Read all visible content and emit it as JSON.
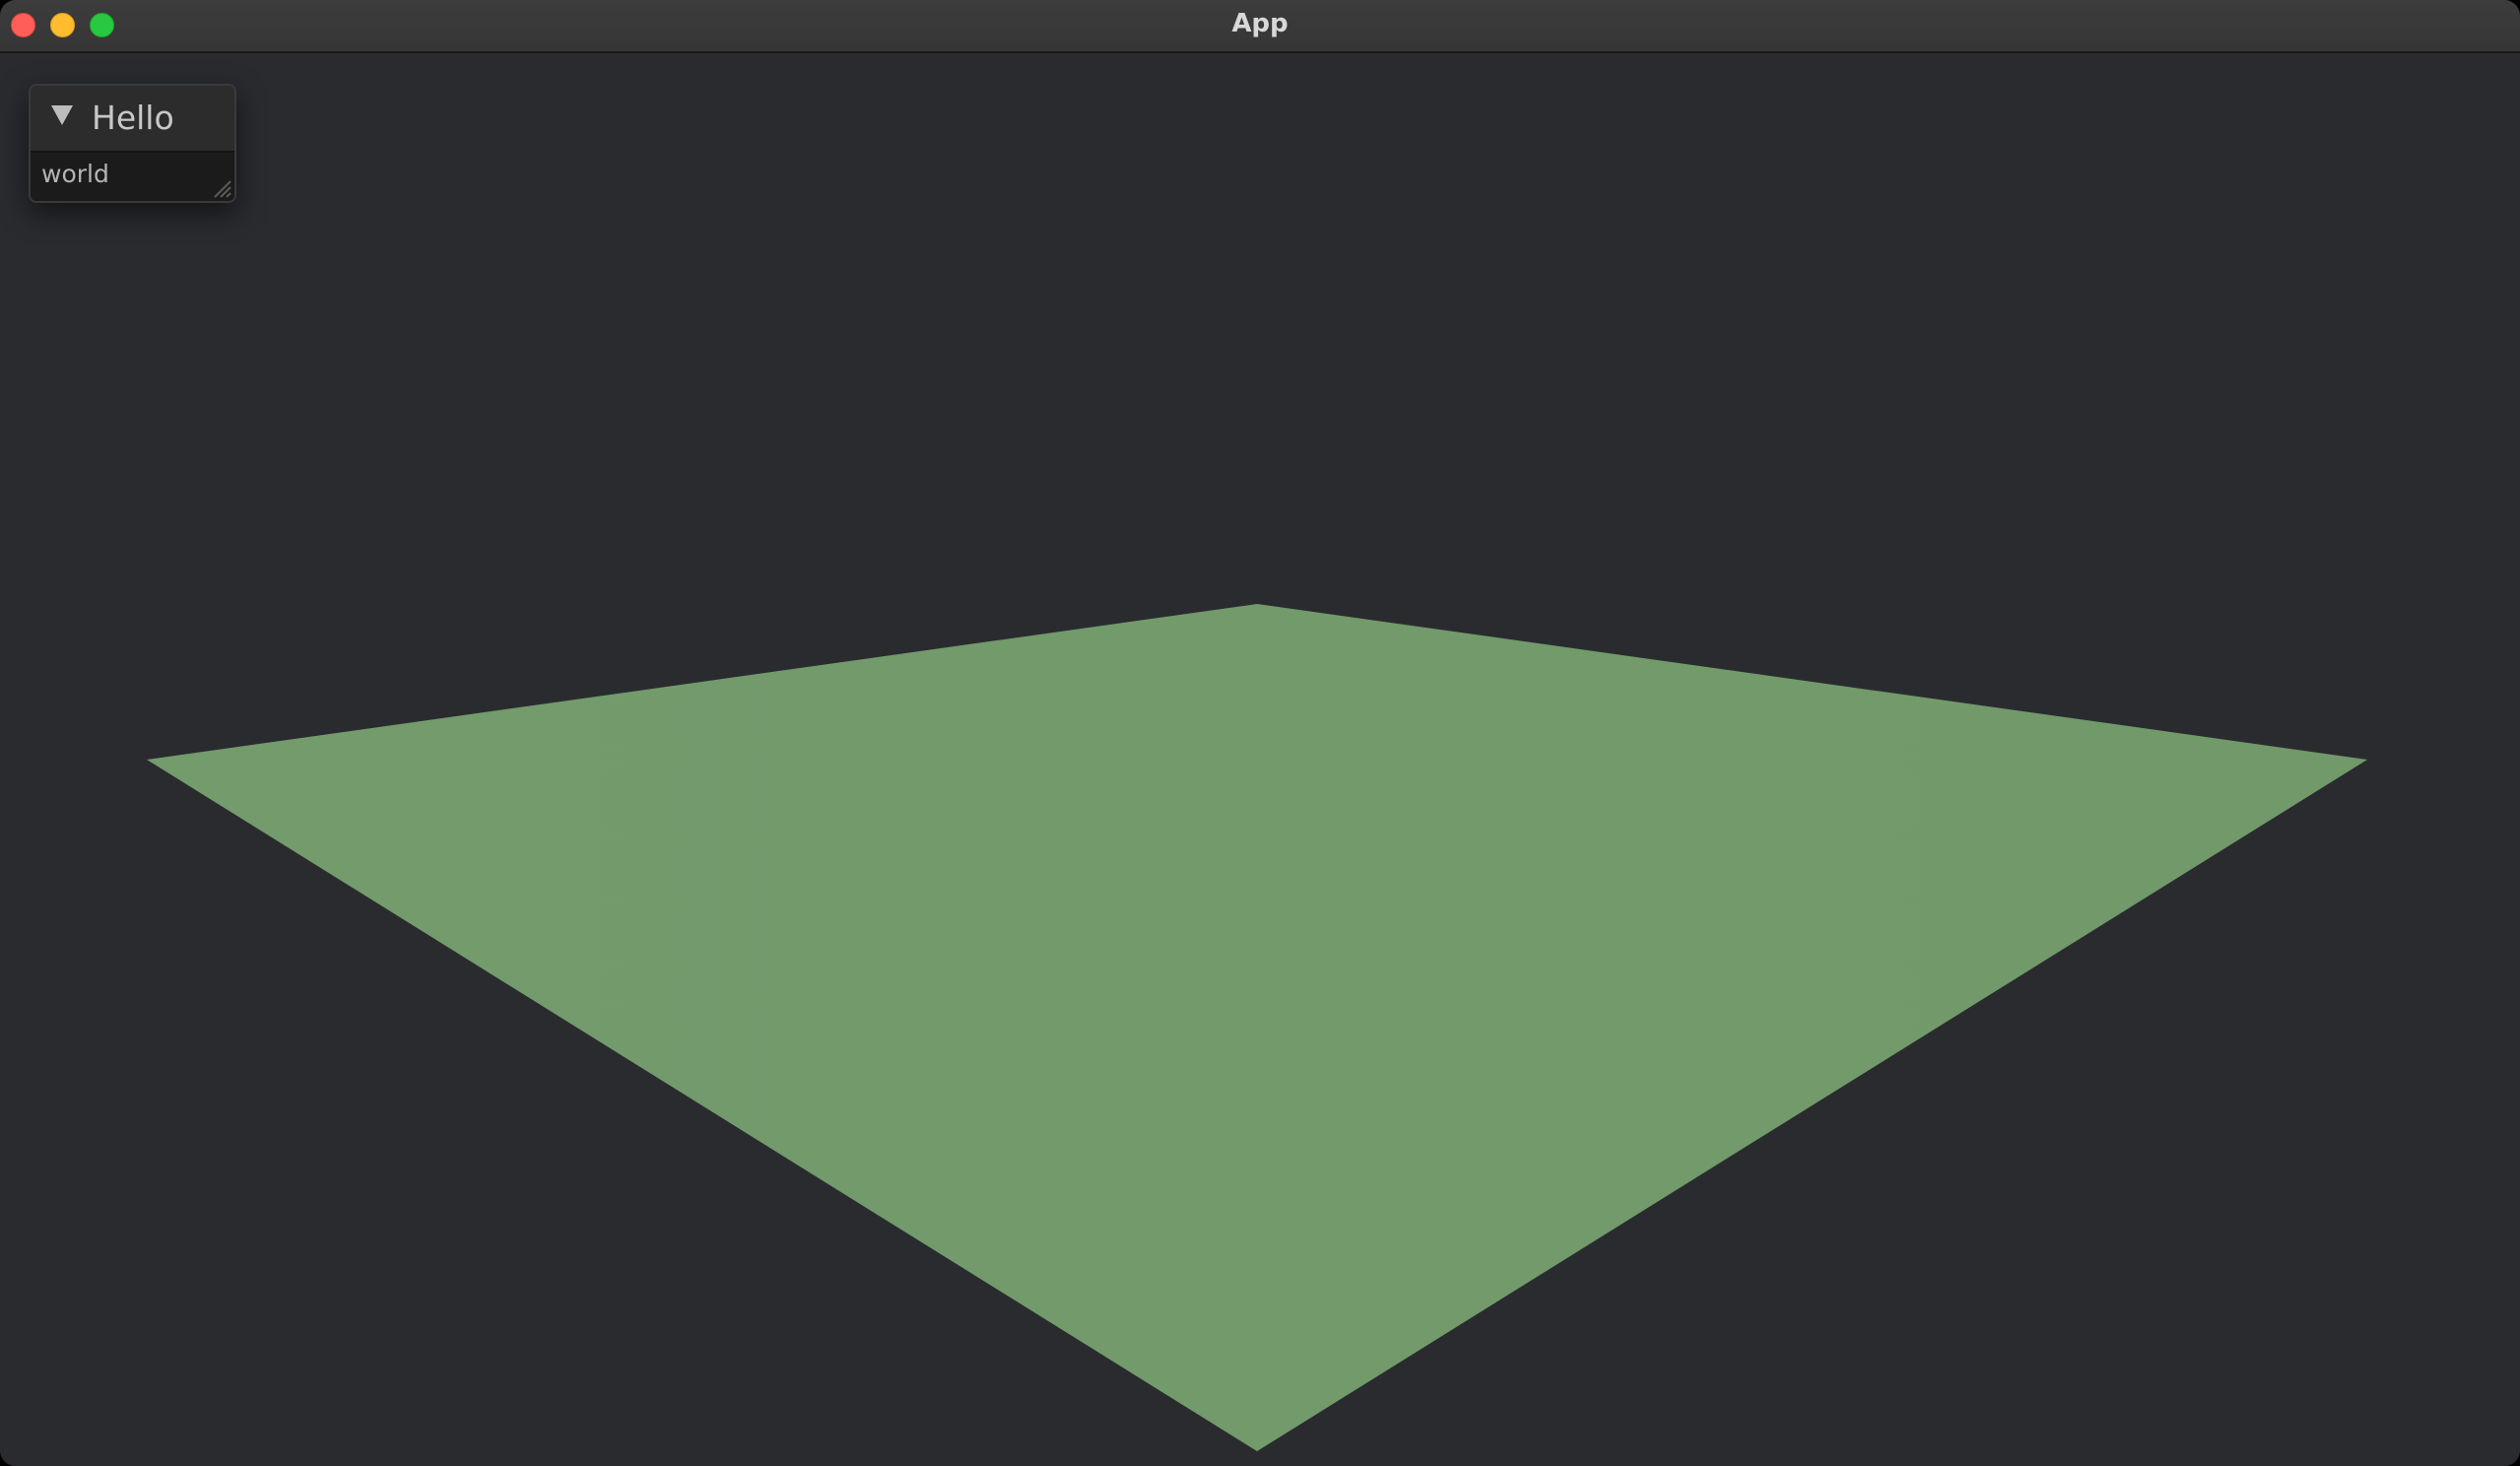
{
  "window": {
    "title": "App"
  },
  "colors": {
    "background": "#2a2b2f",
    "titlebar": "#383838",
    "plane": "#729a6b",
    "panel": "#1e1e1e"
  },
  "panel": {
    "title": "Hello",
    "collapse_icon": "triangle-down-icon",
    "collapsed": false,
    "body_text": "world"
  }
}
